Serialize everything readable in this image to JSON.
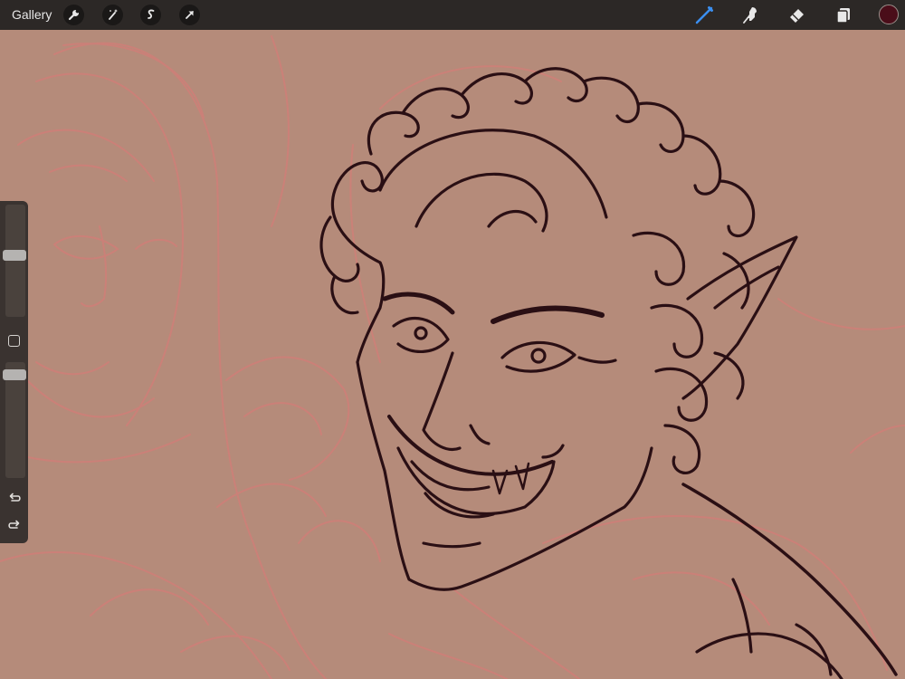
{
  "topbar": {
    "gallery_label": "Gallery",
    "left_tools": [
      "wrench-icon",
      "magic-wand-icon",
      "selection-icon",
      "transform-arrow-icon"
    ],
    "right_tools": [
      "brush-icon",
      "smudge-icon",
      "eraser-icon",
      "layers-icon"
    ],
    "active_tool": "brush",
    "current_color": "#4a0d19",
    "accent_color": "#3b8ff0"
  },
  "sidebar": {
    "brush_size_level": 0.15,
    "opacity_level": 0.05
  },
  "canvas": {
    "background_color": "#b58b7a",
    "sketch_color": "#d2807a",
    "ink_color": "#2a0f14"
  }
}
